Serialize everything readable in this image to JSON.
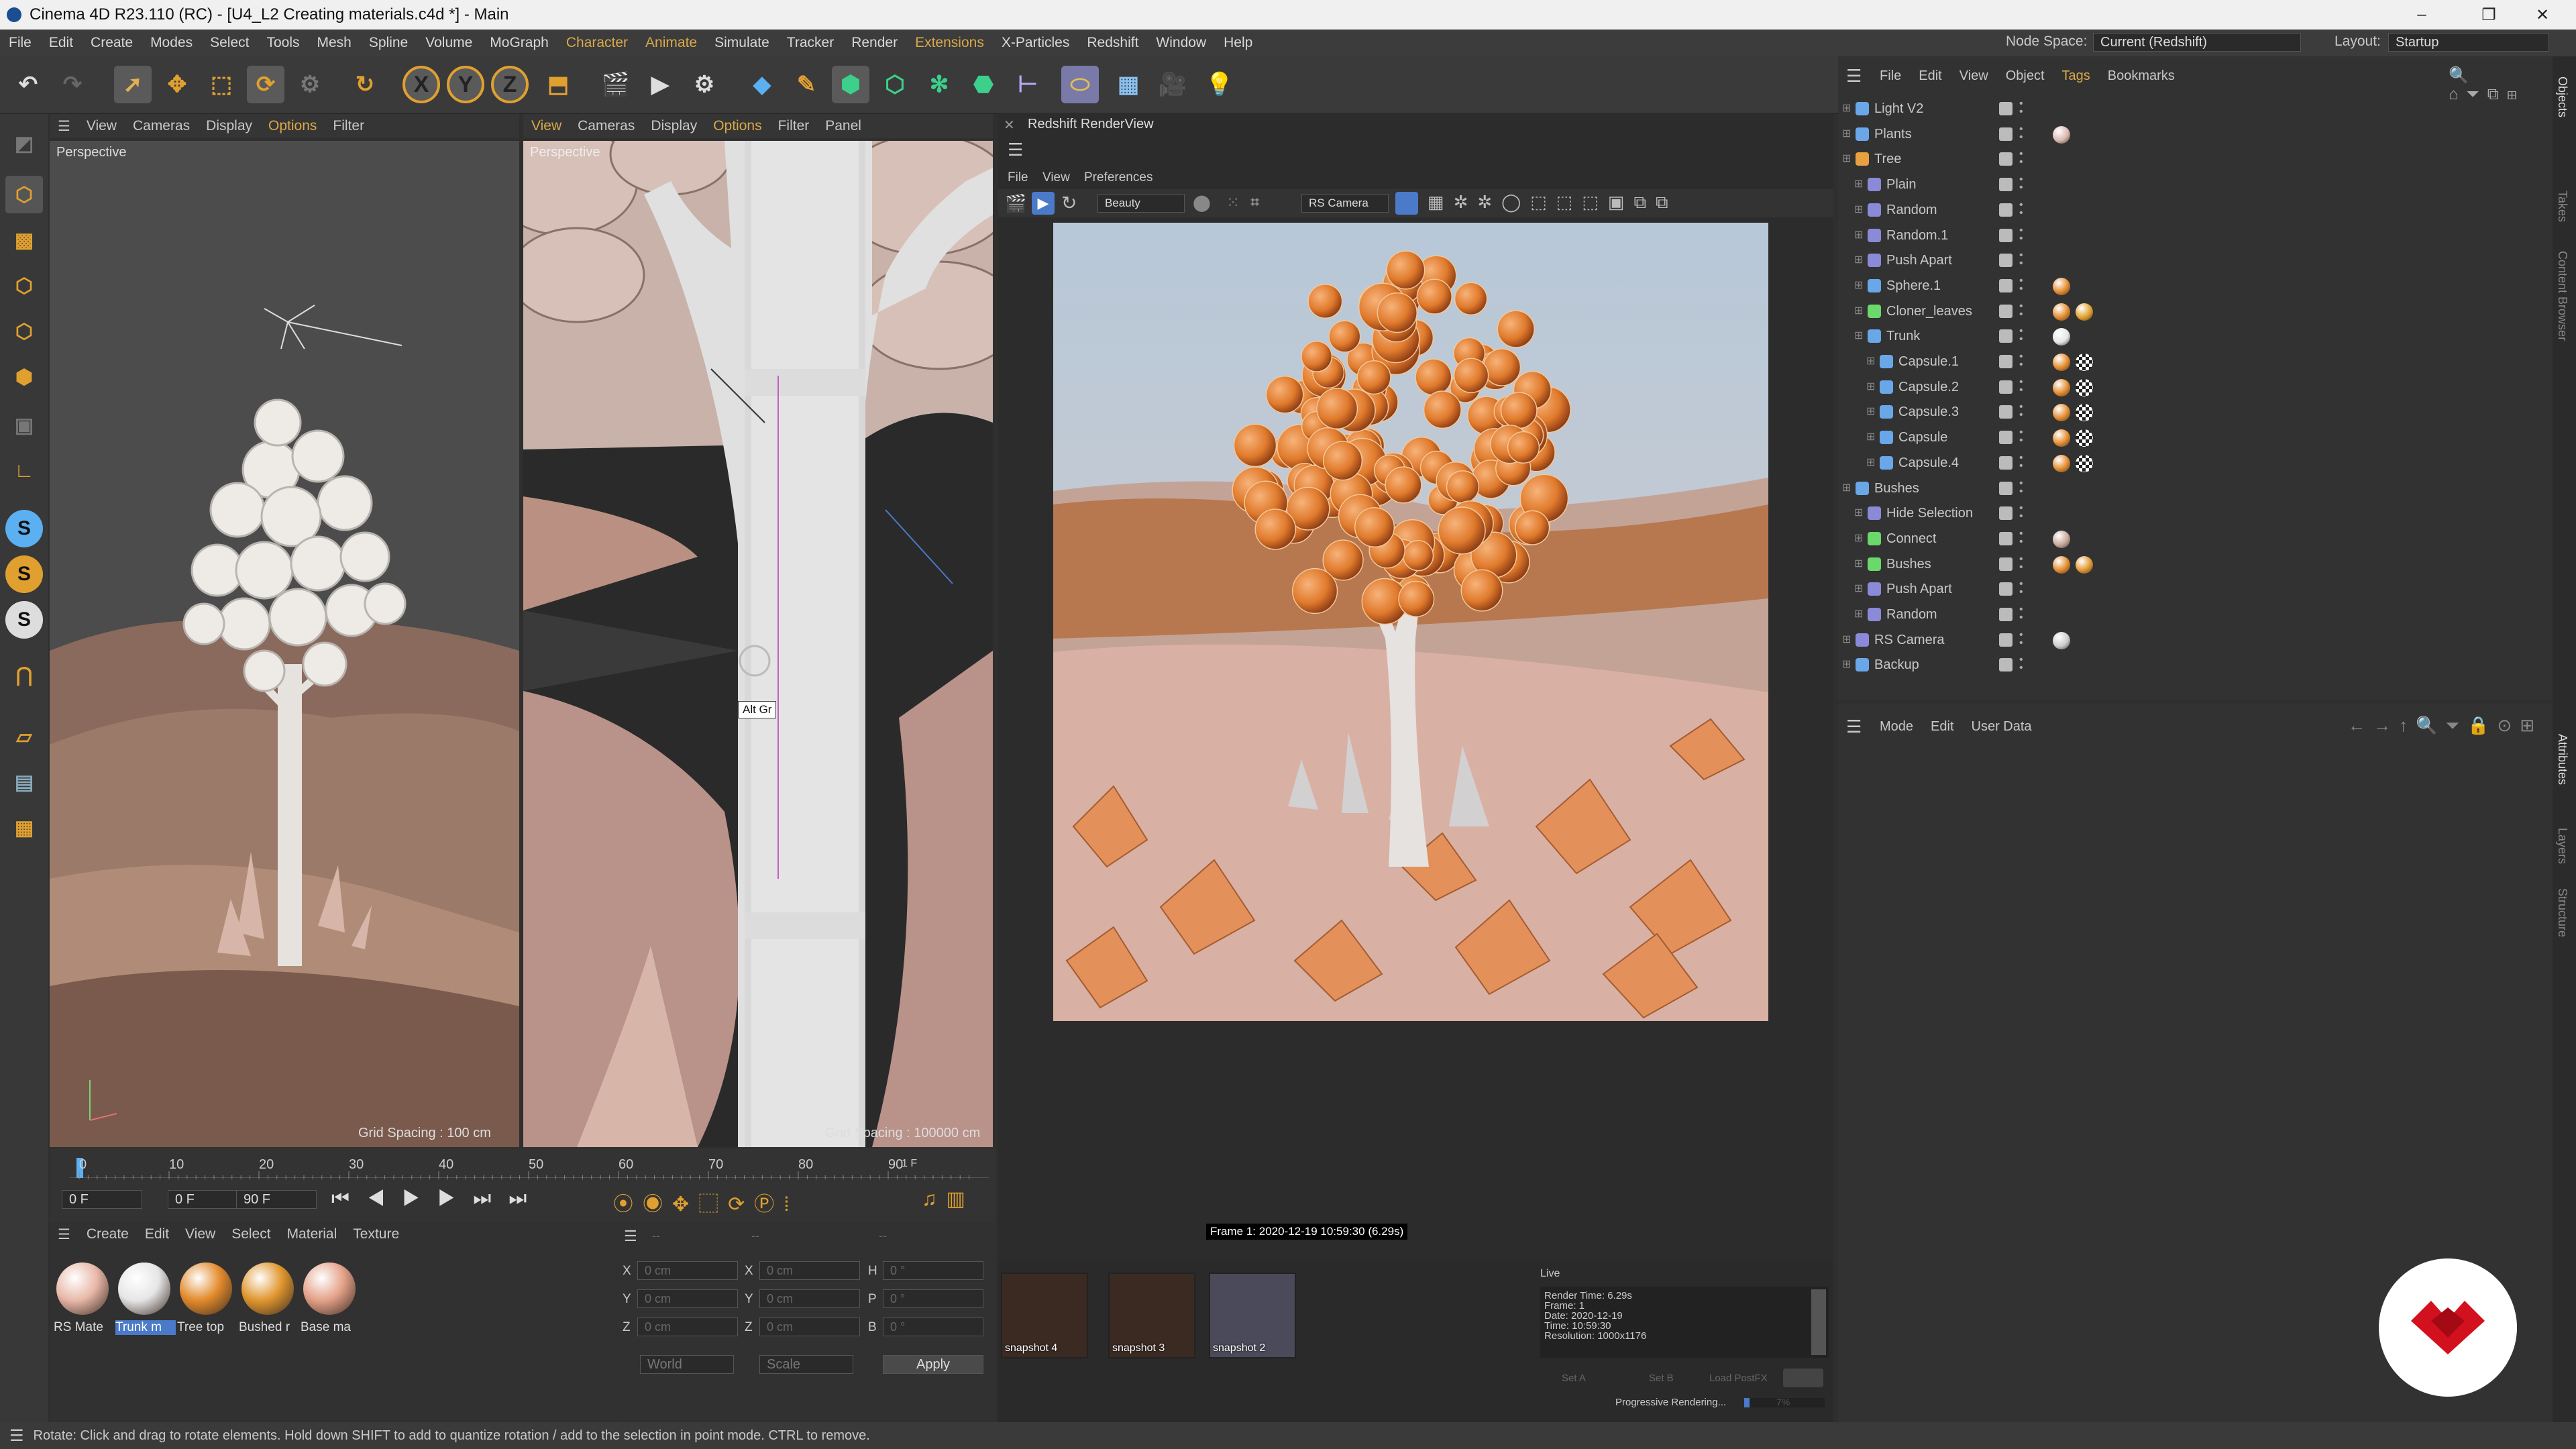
{
  "window": {
    "title": "Cinema 4D R23.110 (RC) - [U4_L2 Creating materials.c4d *] - Main",
    "minimize": "–",
    "restore": "❐",
    "close": "✕"
  },
  "menubar": {
    "items": [
      "File",
      "Edit",
      "Create",
      "Modes",
      "Select",
      "Tools",
      "Mesh",
      "Spline",
      "Volume",
      "MoGraph",
      "Character",
      "Animate",
      "Simulate",
      "Tracker",
      "Render",
      "Extensions",
      "X-Particles",
      "Redshift",
      "Window",
      "Help"
    ],
    "highlighted": [
      "Character",
      "Animate",
      "Extensions"
    ],
    "node_space_label": "Node Space:",
    "node_space_value": "Current (Redshift)",
    "layout_label": "Layout:",
    "layout_value": "Startup"
  },
  "viewport1": {
    "menu": [
      "View",
      "Cameras",
      "Display",
      "Options",
      "Filter"
    ],
    "label": "Perspective",
    "grid": "Grid Spacing : 100 cm"
  },
  "viewport2": {
    "menu": [
      "View",
      "Cameras",
      "Display",
      "Options",
      "Filter",
      "Panel"
    ],
    "label": "Perspective",
    "grid": "Grid Spacing : 100000 cm",
    "tooltip": "Alt Gr"
  },
  "timeline": {
    "ticks": [
      "0",
      "10",
      "20",
      "30",
      "40",
      "50",
      "60",
      "70",
      "80",
      "90"
    ],
    "current": "1 F",
    "start": "0 F",
    "start2": "0 F",
    "end": "90 F"
  },
  "materials": {
    "menu": [
      "Create",
      "Edit",
      "View",
      "Select",
      "Material",
      "Texture"
    ],
    "items": [
      {
        "name": "RS Mate",
        "color": "#e8b8a8",
        "selected": false
      },
      {
        "name": "Trunk m",
        "color": "#e6e6e6",
        "selected": true
      },
      {
        "name": "Tree top",
        "color": "#e38a2b",
        "selected": false
      },
      {
        "name": "Bushed r",
        "color": "#e0962e",
        "selected": false
      },
      {
        "name": "Base ma",
        "color": "#e4a188",
        "selected": false
      }
    ]
  },
  "coords": {
    "headers": [
      "--",
      "--",
      "--"
    ],
    "rows": [
      {
        "a": "X",
        "av": "0 cm",
        "b": "X",
        "bv": "0 cm",
        "c": "H",
        "cv": "0 °"
      },
      {
        "a": "Y",
        "av": "0 cm",
        "b": "Y",
        "bv": "0 cm",
        "c": "P",
        "cv": "0 °"
      },
      {
        "a": "Z",
        "av": "0 cm",
        "b": "Z",
        "bv": "0 cm",
        "c": "B",
        "cv": "0 °"
      }
    ],
    "world": "World",
    "scale": "Scale",
    "apply": "Apply"
  },
  "render": {
    "title": "Redshift RenderView",
    "menu": [
      "File",
      "View",
      "Preferences"
    ],
    "aov": "Beauty",
    "camera": "RS Camera",
    "frame": "Frame  1:  2020-12-19  10:59:30  (6.29s)",
    "snapshots": [
      "snapshot 4",
      "snapshot 3",
      "snapshot 2"
    ],
    "live": "Live",
    "info": [
      "Render Time: 6.29s",
      "Frame: 1",
      "Date: 2020-12-19",
      "Time: 10:59:30",
      "Resolution: 1000x1176"
    ],
    "set_a": "Set A",
    "set_b": "Set B",
    "load_postfx": "Load PostFX",
    "progressive": "Progressive Rendering...",
    "progress_pct": "7%",
    "progress": 0.07
  },
  "objects": {
    "menu": [
      "File",
      "Edit",
      "View",
      "Object",
      "Tags",
      "Bookmarks"
    ],
    "rows": [
      {
        "name": "Light V2",
        "indent": 0,
        "icon": "#6aa7e8",
        "tags": []
      },
      {
        "name": "Plants",
        "indent": 0,
        "icon": "#6aa7e8",
        "tags": [
          "#d9b8b0"
        ]
      },
      {
        "name": "Tree",
        "indent": 0,
        "icon": "#e8a040",
        "tags": []
      },
      {
        "name": "Plain",
        "indent": 1,
        "icon": "#8a8ad8",
        "tags": []
      },
      {
        "name": "Random",
        "indent": 1,
        "icon": "#8a8ad8",
        "tags": []
      },
      {
        "name": "Random.1",
        "indent": 1,
        "icon": "#8a8ad8",
        "tags": []
      },
      {
        "name": "Push Apart",
        "indent": 1,
        "icon": "#8a8ad8",
        "tags": []
      },
      {
        "name": "Sphere.1",
        "indent": 1,
        "icon": "#6aa7e8",
        "tags": [
          "#e38a2b"
        ]
      },
      {
        "name": "Cloner_leaves",
        "indent": 1,
        "icon": "#6ad86a",
        "tags": [
          "#e38a2b",
          "#e3a02b"
        ]
      },
      {
        "name": "Trunk",
        "indent": 1,
        "icon": "#6aa7e8",
        "tags": [
          "#e6e6e6"
        ]
      },
      {
        "name": "Capsule.1",
        "indent": 2,
        "icon": "#6aa7e8",
        "tags": [
          "#e38a2b",
          "#ffffff"
        ]
      },
      {
        "name": "Capsule.2",
        "indent": 2,
        "icon": "#6aa7e8",
        "tags": [
          "#e38a2b",
          "#ffffff"
        ]
      },
      {
        "name": "Capsule.3",
        "indent": 2,
        "icon": "#6aa7e8",
        "tags": [
          "#e38a2b",
          "#ffffff"
        ]
      },
      {
        "name": "Capsule",
        "indent": 2,
        "icon": "#6aa7e8",
        "tags": [
          "#e38a2b",
          "#ffffff"
        ]
      },
      {
        "name": "Capsule.4",
        "indent": 2,
        "icon": "#6aa7e8",
        "tags": [
          "#e38a2b",
          "#ffffff"
        ]
      },
      {
        "name": "Bushes",
        "indent": 0,
        "icon": "#6aa7e8",
        "tags": []
      },
      {
        "name": "Hide Selection",
        "indent": 1,
        "icon": "#8a8ad8",
        "tags": []
      },
      {
        "name": "Connect",
        "indent": 1,
        "icon": "#6ad86a",
        "tags": [
          "#c8a898"
        ]
      },
      {
        "name": "Bushes",
        "indent": 1,
        "icon": "#6ad86a",
        "tags": [
          "#e38a2b",
          "#e0962e"
        ]
      },
      {
        "name": "Push Apart",
        "indent": 1,
        "icon": "#8a8ad8",
        "tags": []
      },
      {
        "name": "Random",
        "indent": 1,
        "icon": "#8a8ad8",
        "tags": []
      },
      {
        "name": "RS Camera",
        "indent": 0,
        "icon": "#8a8ad8",
        "tags": [
          "#cccccc"
        ]
      },
      {
        "name": "Backup",
        "indent": 0,
        "icon": "#6aa7e8",
        "tags": []
      }
    ]
  },
  "attributes": {
    "menu": [
      "Mode",
      "Edit",
      "User Data"
    ]
  },
  "right_tabs": [
    "Objects",
    "Takes",
    "Content Browser",
    "Attributes",
    "Layers",
    "Structure"
  ],
  "status": "Rotate: Click and drag to rotate elements. Hold down SHIFT to add to quantize rotation / add to the selection in point mode. CTRL to remove."
}
